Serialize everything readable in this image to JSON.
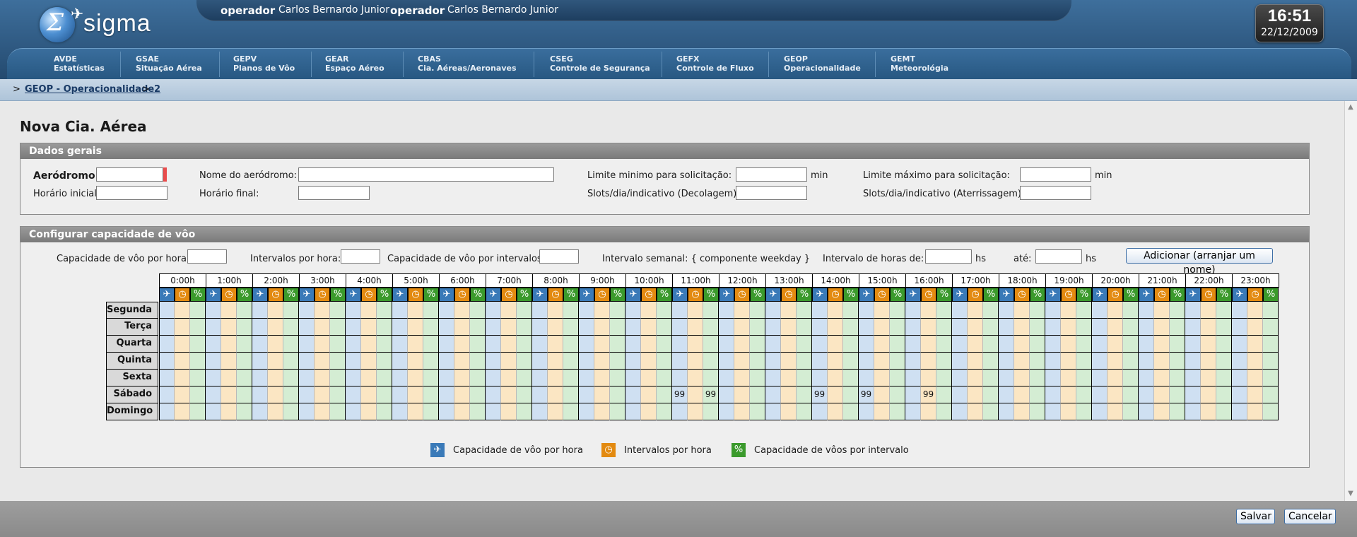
{
  "app": {
    "logo_text": "sigma"
  },
  "userbar": {
    "role1": "operador",
    "name1": "Carlos Bernardo Junior",
    "role2": "operador",
    "name2": "Carlos Bernardo Junior"
  },
  "clock": {
    "time": "16:51",
    "date": "22/12/2009"
  },
  "nav": [
    {
      "code": "AVDE",
      "label": "Estatísticas"
    },
    {
      "code": "GSAE",
      "label": "Situação Aérea"
    },
    {
      "code": "GEPV",
      "label": "Planos de Vôo"
    },
    {
      "code": "GEAR",
      "label": "Espaço Aéreo"
    },
    {
      "code": "CBAS",
      "label": "Cia. Aéreas/Aeronaves"
    },
    {
      "code": "CSEG",
      "label": "Controle de Segurança"
    },
    {
      "code": "GEFX",
      "label": "Controle de Fluxo"
    },
    {
      "code": "GEOP",
      "label": "Operacionalidade"
    },
    {
      "code": "GEMT",
      "label": "Meteorológia"
    }
  ],
  "breadcrumb": {
    "sep1": ">",
    "link1": "GEOP - Operacionalidade",
    "sep2": ">",
    "link2": "2"
  },
  "page": {
    "title": "Nova Cia. Aérea"
  },
  "dados_gerais": {
    "header": "Dados gerais",
    "aerodromo_label": "Aeródromo:",
    "nome_aerodromo_label": "Nome do aeródromo:",
    "limite_min_label": "Limite minimo para solicitação:",
    "limite_min_unit": "min",
    "limite_max_label": "Limite máximo para solicitação:",
    "limite_max_unit": "min",
    "horario_inicial_label": "Horário inicial:",
    "horario_final_label": "Horário final:",
    "slots_dec_label": "Slots/dia/indicativo (Decolagem):",
    "slots_ate_label": "Slots/dia/indicativo (Aterrissagem):"
  },
  "configurar": {
    "header": "Configurar capacidade de vôo",
    "cap_hora_label": "Capacidade de vôo por hora:",
    "intervalos_label": "Intervalos por hora:",
    "cap_intervalos_label": "Capacidade de vôo por intervalos:",
    "semanal_label": "Intervalo semanal: { componente weekday }",
    "horas_de_label": "Intervalo de horas de:",
    "hs1": "hs",
    "ate_label": "até:",
    "hs2": "hs",
    "add_button": "Adicionar (arranjar um nome)"
  },
  "schedule": {
    "hours": [
      "0:00h",
      "1:00h",
      "2:00h",
      "3:00h",
      "4:00h",
      "5:00h",
      "6:00h",
      "7:00h",
      "8:00h",
      "9:00h",
      "10:00h",
      "11:00h",
      "12:00h",
      "13:00h",
      "14:00h",
      "15:00h",
      "16:00h",
      "17:00h",
      "18:00h",
      "19:00h",
      "20:00h",
      "21:00h",
      "22:00h",
      "23:00h"
    ],
    "days": [
      "Segunda",
      "Terça",
      "Quarta",
      "Quinta",
      "Sexta",
      "Sábado",
      "Domingo"
    ],
    "values": [
      {
        "day": 5,
        "hour": 11,
        "col": 0,
        "value": "99"
      },
      {
        "day": 5,
        "hour": 11,
        "col": 2,
        "value": "99"
      },
      {
        "day": 5,
        "hour": 14,
        "col": 0,
        "value": "99"
      },
      {
        "day": 5,
        "hour": 15,
        "col": 0,
        "value": "99"
      },
      {
        "day": 5,
        "hour": 16,
        "col": 1,
        "value": "99"
      }
    ],
    "icons": [
      "airplane-icon",
      "clock-icon",
      "airplane-percent-icon"
    ],
    "colors": {
      "flight": "#3a7ab8",
      "interval": "#e38a10",
      "capacity": "#3b9a2c"
    }
  },
  "legend": [
    {
      "icon": "airplane-icon",
      "label": "Capacidade de vôo por hora"
    },
    {
      "icon": "clock-icon",
      "label": "Intervalos por hora"
    },
    {
      "icon": "airplane-percent-icon",
      "label": "Capacidade de vôos por intervalo"
    }
  ],
  "footer": {
    "save": "Salvar",
    "cancel": "Cancelar"
  }
}
